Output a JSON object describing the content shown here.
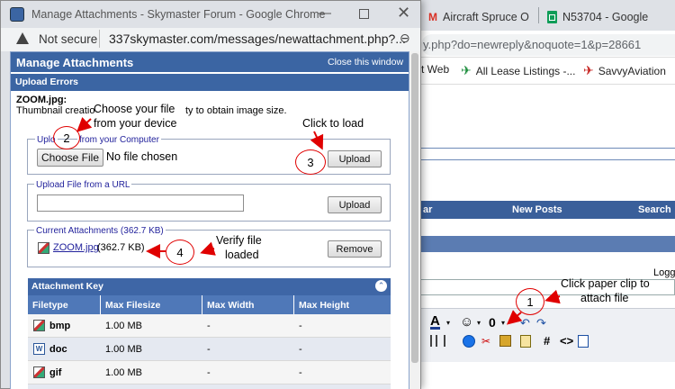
{
  "bg": {
    "tabs": [
      {
        "label": "Aircraft Spruce O",
        "icon": "gmail-icon"
      },
      {
        "label": "N53704 - Google",
        "icon": "sheets-icon"
      }
    ],
    "address": "y.php?do=newreply&noquote=1&p=28661",
    "bookmarks": [
      "t Web",
      "All Lease Listings -...",
      "SavvyAviation"
    ],
    "nav": {
      "a": "ar",
      "new_posts": "New Posts",
      "search": "Search"
    },
    "logged": "Logge"
  },
  "popup": {
    "window_title": "Manage Attachments - Skymaster Forum - Google Chrome",
    "not_secure": "Not secure",
    "url": "337skymaster.com/messages/newattachment.php?...",
    "header_title": "Manage Attachments",
    "close_link": "Close this window",
    "upload_errors": "Upload Errors",
    "error_file": "ZOOM.jpg",
    "error_msg_a": "Thumbnail creatio",
    "error_msg_b": "ty to obtain image size.",
    "computer_legend_a": "Uplo",
    "computer_legend_b": "from your Computer",
    "choose_file": "Choose File",
    "no_file": "No file chosen",
    "upload": "Upload",
    "url_legend": "Upload File from a URL",
    "url_value": "",
    "current_legend": "Current Attachments (362.7 KB)",
    "attachment_name": "ZOOM.jpg",
    "attachment_size": "(362.7 KB)",
    "remove": "Remove",
    "key_title": "Attachment Key",
    "key_headers": [
      "Filetype",
      "Max Filesize",
      "Max Width",
      "Max Height"
    ],
    "key_rows": [
      {
        "type": "bmp",
        "size": "1.00 MB",
        "w": "-",
        "h": "-"
      },
      {
        "type": "doc",
        "size": "1.00 MB",
        "w": "-",
        "h": "-"
      },
      {
        "type": "gif",
        "size": "1.00 MB",
        "w": "-",
        "h": "-"
      }
    ]
  },
  "annotations": {
    "a1": "Choose your file",
    "a1b": "from your device",
    "a2": "Click to load",
    "a3": "Verify file",
    "a3b": "loaded",
    "a4": "Click paper clip to",
    "a4b": "attach file",
    "n1": "1",
    "n2": "2",
    "n3": "3",
    "n4": "4"
  },
  "colors": {
    "header_blue": "#3b65a3",
    "red": "#e00000",
    "key_blue": "#3e66a6"
  }
}
